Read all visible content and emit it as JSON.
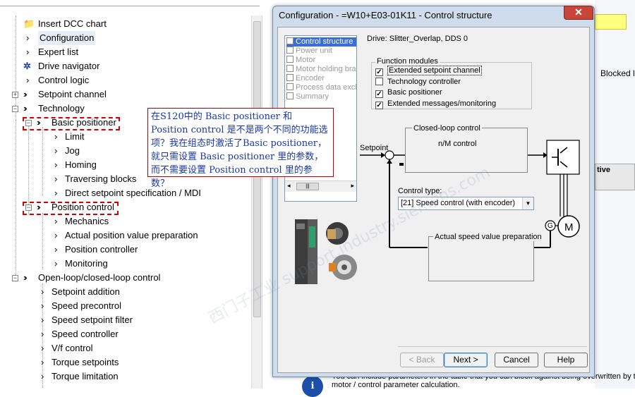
{
  "tree": {
    "items": [
      {
        "label": "Insert DCC chart"
      },
      {
        "label": "Configuration"
      },
      {
        "label": "Expert list"
      },
      {
        "label": "Drive navigator"
      },
      {
        "label": "Control logic"
      },
      {
        "label": "Setpoint channel"
      },
      {
        "label": "Technology"
      },
      {
        "label": "Basic positioner"
      },
      {
        "label": "Limit"
      },
      {
        "label": "Jog"
      },
      {
        "label": "Homing"
      },
      {
        "label": "Traversing blocks"
      },
      {
        "label": "Direct setpoint specification / MDI"
      },
      {
        "label": "Position control"
      },
      {
        "label": "Mechanics"
      },
      {
        "label": "Actual position value preparation"
      },
      {
        "label": "Position controller"
      },
      {
        "label": "Monitoring"
      },
      {
        "label": "Open-loop/closed-loop control"
      },
      {
        "label": "Setpoint addition"
      },
      {
        "label": "Speed precontrol"
      },
      {
        "label": "Speed setpoint filter"
      },
      {
        "label": "Speed controller"
      },
      {
        "label": "V/f control"
      },
      {
        "label": "Torque setpoints"
      },
      {
        "label": "Torque limitation"
      }
    ]
  },
  "note": {
    "text": "在S120中的 Basic positioner 和 Position control 是不是两个不同的功能选项？我在组态时激活了Basic positioner，就只需设置 Basic positioner 里的参数，而不需要设置 Position control 里的参数？"
  },
  "dialog": {
    "title": "Configuration - =W10+E03-01K11 - Control structure",
    "close_label": "✕",
    "drive_label": "Drive: Slitter_Overlap, DDS 0",
    "steps": [
      {
        "label": "Control structure",
        "selected": true
      },
      {
        "label": "Power unit"
      },
      {
        "label": "Motor"
      },
      {
        "label": "Motor holding brake"
      },
      {
        "label": "Encoder"
      },
      {
        "label": "Process data exchange"
      },
      {
        "label": "Summary"
      }
    ],
    "function_modules": {
      "caption": "Function modules",
      "items": [
        {
          "label": "Extended setpoint channel",
          "checked": true
        },
        {
          "label": "Technology controller",
          "checked": false
        },
        {
          "label": "Basic positioner",
          "checked": true
        },
        {
          "label": "Extended messages/monitoring",
          "checked": true
        }
      ]
    },
    "diagram": {
      "setpoint_label": "Setpoint",
      "closed_loop_label": "Closed-loop control",
      "nm_control_label": "n/M control",
      "control_type_label": "Control type:",
      "control_type_value": "[21] Speed control (with encoder)",
      "actual_speed_label": "Actual speed value preparation",
      "motor_label": "M",
      "encoder_label": "G"
    },
    "buttons": {
      "back": "< Back",
      "next": "Next >",
      "cancel": "Cancel",
      "help": "Help"
    }
  },
  "background_app": {
    "blocked_label": "Blocked lis",
    "table_header": "tive",
    "button_label": "...",
    "bottom_text": "You can include parameters in the table that you can block against being overwritten by the",
    "bottom_text2": "motor / control parameter calculation."
  },
  "watermark": "西门子工业  support.industry.siemens.com"
}
